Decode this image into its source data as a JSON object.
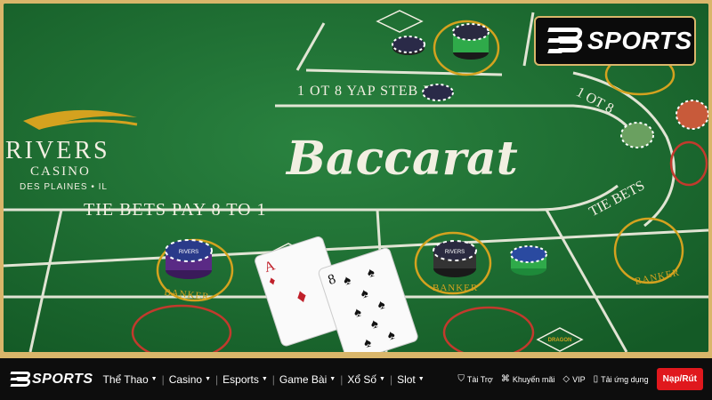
{
  "brand": {
    "logo_text": "SPORTS"
  },
  "scene": {
    "casino_name": "RIVERS",
    "casino_sub": "CASINO",
    "casino_loc": "DES PLAINES • IL",
    "game_title": "Baccarat",
    "tie_bets_left": "TIE BETS PAY 8 TO 1",
    "tie_bets_top": "1 OT 8 YAP STEB EIT",
    "tie_bets_top_right": "1 OT 8",
    "tie_bets_right": "TIE BETS",
    "banker": "BANKER",
    "chip_label": "RIVERS",
    "cards": [
      {
        "rank": "A",
        "suit": "♦"
      },
      {
        "rank": "8",
        "suit": "♠"
      }
    ]
  },
  "nav": {
    "items": [
      {
        "label": "Thể Thao"
      },
      {
        "label": "Casino"
      },
      {
        "label": "Esports"
      },
      {
        "label": "Game Bài"
      },
      {
        "label": "Xổ Số"
      },
      {
        "label": "Slot"
      }
    ],
    "utils": [
      {
        "label": "Tài Trợ",
        "icon": "shield-icon"
      },
      {
        "label": "Khuyến mãi",
        "icon": "tag-icon"
      },
      {
        "label": "VIP",
        "icon": "diamond-icon"
      },
      {
        "label": "Tải ứng dụng",
        "icon": "phone-icon"
      }
    ],
    "cta": "Nạp/Rút"
  }
}
